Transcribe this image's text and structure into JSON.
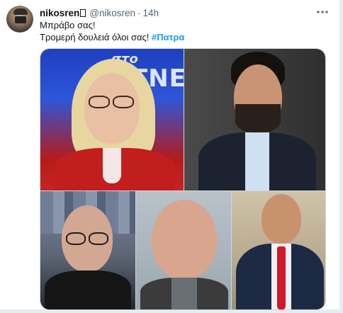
{
  "tweet": {
    "display_name": "nikosren",
    "handle": "@nikosren",
    "separator": "·",
    "time": "14h",
    "more_icon": "more-icon",
    "line1": "Μπράβο σας!",
    "line2_prefix": "Τρομερή δουλειά όλοι σας!",
    "hashtag": "#Πατρα"
  },
  "media": {
    "tv_text_top": "στο",
    "tv_text_bottom": "TNEA"
  },
  "colors": {
    "accent": "#1d9bf0",
    "secondary_text": "#536471",
    "primary_text": "#0f1419"
  }
}
